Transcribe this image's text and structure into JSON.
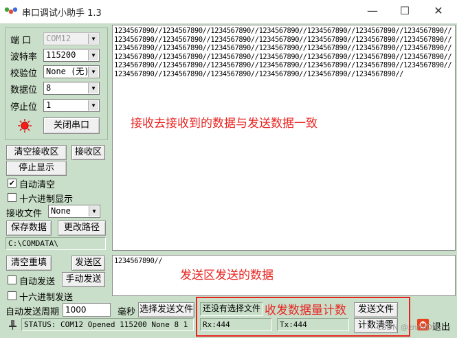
{
  "window": {
    "title": "串口调试小助手 1.3",
    "minimize": "—",
    "maximize": "☐",
    "close": "✕"
  },
  "settings": {
    "port_label": "端 口",
    "port_value": "COM12",
    "baud_label": "波特率",
    "baud_value": "115200",
    "parity_label": "校验位",
    "parity_value": "None (无)",
    "databits_label": "数据位",
    "databits_value": "8",
    "stopbits_label": "停止位",
    "stopbits_value": "1",
    "close_port_button": "关闭串口",
    "indicator_color": "#ff0000"
  },
  "receive": {
    "clear_button": "清空接收区",
    "area_label": "接收区",
    "stop_display_button": "停止显示",
    "auto_clear_label": "自动清空",
    "auto_clear_checked": "✔",
    "hex_display_label": "十六进制显示",
    "file_label": "接收文件",
    "file_value": "None",
    "save_button": "保存数据",
    "change_path_button": "更改路径",
    "path_value": "C:\\COMDATA\\",
    "text": "1234567890//1234567890//1234567890//1234567890//1234567890//1234567890//1234567890//1234567890//1234567890//1234567890//1234567890//1234567890//1234567890//1234567890//1234567890//1234567890//1234567890//1234567890//1234567890//1234567890//1234567890//1234567890//1234567890//1234567890//1234567890//1234567890//1234567890//1234567890//1234567890//1234567890//1234567890//1234567890//1234567890//1234567890//1234567890//1234567890//1234567890//1234567890//1234567890//1234567890//1234567890//",
    "annotation": "接收去接收到的数据与发送数据一致"
  },
  "send": {
    "clear_button": "清空重填",
    "area_label": "发送区",
    "auto_send_label": "自动发送",
    "manual_send_button": "手动发送",
    "hex_send_label": "十六进制发送",
    "period_label": "自动发送周期",
    "period_value": "1000",
    "period_unit": "毫秒",
    "select_file_button": "选择发送文件",
    "no_file_label": "还没有选择文件",
    "send_file_button": "发送文件",
    "text": "1234567890//",
    "annotation": "发送区发送的数据"
  },
  "status": {
    "status_text": "STATUS: COM12 Opened 115200 None  8 1",
    "rx": "Rx:444",
    "tx": "Tx:444",
    "reset_count_button": "计数清零",
    "exit_label": "退出",
    "count_annotation": "收发数据量计数",
    "watermark": "CSDN @znmlDH"
  }
}
